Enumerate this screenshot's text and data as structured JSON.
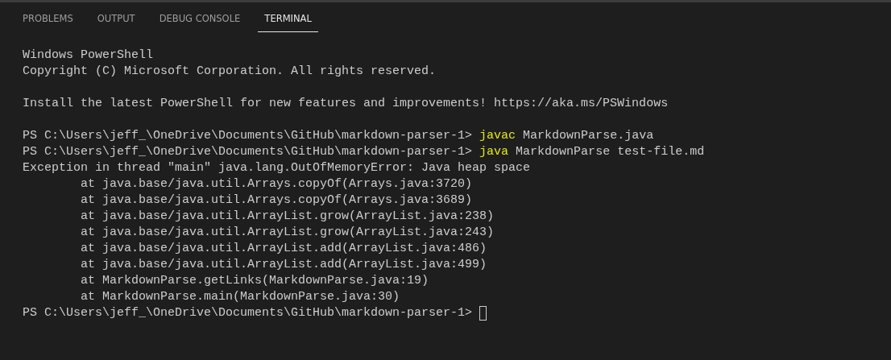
{
  "panel_tabs": [
    {
      "label": "PROBLEMS",
      "selected": false
    },
    {
      "label": "OUTPUT",
      "selected": false
    },
    {
      "label": "DEBUG CONSOLE",
      "selected": false
    },
    {
      "label": "TERMINAL",
      "selected": true
    }
  ],
  "terminal": {
    "lines": [
      {
        "kind": "output",
        "text": "Windows PowerShell"
      },
      {
        "kind": "output",
        "text": "Copyright (C) Microsoft Corporation. All rights reserved."
      },
      {
        "kind": "blank"
      },
      {
        "kind": "output",
        "text": "Install the latest PowerShell for new features and improvements! https://aka.ms/PSWindows"
      },
      {
        "kind": "blank"
      },
      {
        "kind": "command",
        "prompt": "PS C:\\Users\\jeff_\\OneDrive\\Documents\\GitHub\\markdown-parser-1>",
        "command": "javac",
        "args": "MarkdownParse.java"
      },
      {
        "kind": "command",
        "prompt": "PS C:\\Users\\jeff_\\OneDrive\\Documents\\GitHub\\markdown-parser-1>",
        "command": "java",
        "args": "MarkdownParse test-file.md"
      },
      {
        "kind": "output",
        "text": "Exception in thread \"main\" java.lang.OutOfMemoryError: Java heap space"
      },
      {
        "kind": "trace",
        "text": "at java.base/java.util.Arrays.copyOf(Arrays.java:3720)"
      },
      {
        "kind": "trace",
        "text": "at java.base/java.util.Arrays.copyOf(Arrays.java:3689)"
      },
      {
        "kind": "trace",
        "text": "at java.base/java.util.ArrayList.grow(ArrayList.java:238)"
      },
      {
        "kind": "trace",
        "text": "at java.base/java.util.ArrayList.grow(ArrayList.java:243)"
      },
      {
        "kind": "trace",
        "text": "at java.base/java.util.ArrayList.add(ArrayList.java:486)"
      },
      {
        "kind": "trace",
        "text": "at java.base/java.util.ArrayList.add(ArrayList.java:499)"
      },
      {
        "kind": "trace",
        "text": "at MarkdownParse.getLinks(MarkdownParse.java:19)"
      },
      {
        "kind": "trace",
        "text": "at MarkdownParse.main(MarkdownParse.java:30)"
      },
      {
        "kind": "prompt",
        "prompt": "PS C:\\Users\\jeff_\\OneDrive\\Documents\\GitHub\\markdown-parser-1>",
        "cursor": true
      }
    ]
  }
}
